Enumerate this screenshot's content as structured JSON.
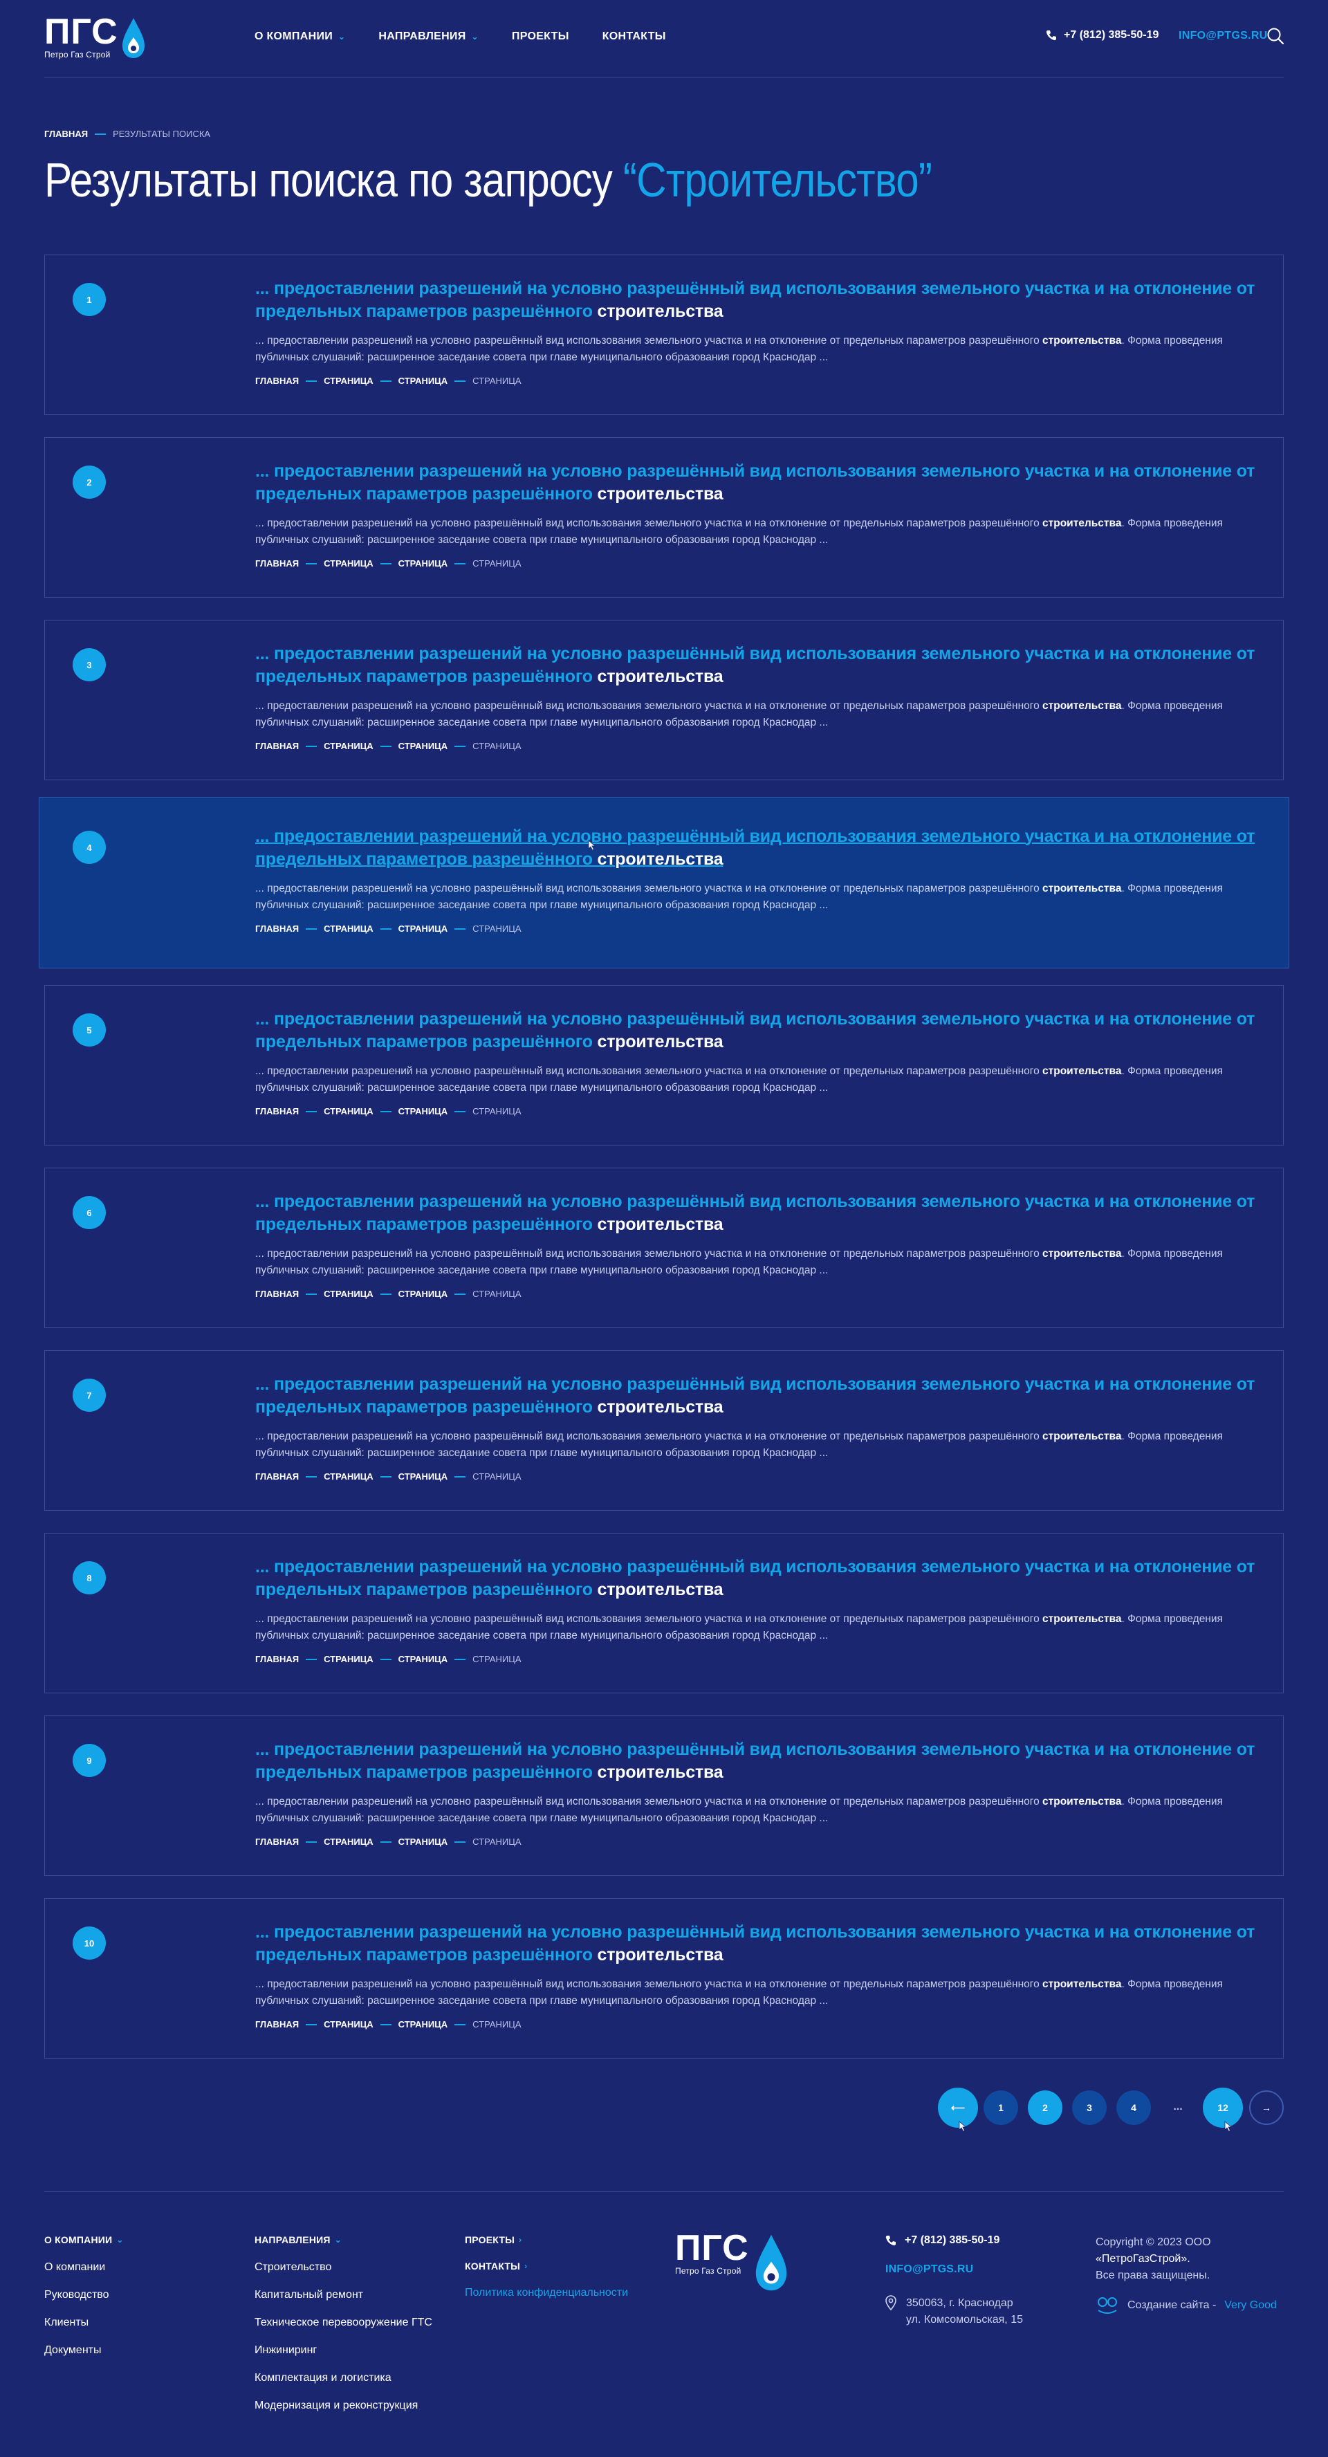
{
  "header": {
    "logo_big": "ПГС",
    "logo_small": "Петро Газ Строй",
    "nav": [
      {
        "label": "О КОМПАНИИ",
        "dropdown": true
      },
      {
        "label": "НАПРАВЛЕНИЯ",
        "dropdown": true
      },
      {
        "label": "ПРОЕКТЫ",
        "dropdown": false
      },
      {
        "label": "КОНТАКТЫ",
        "dropdown": false
      }
    ],
    "phone": "+7 (812) 385-50-19",
    "email": "INFO@PTGS.RU"
  },
  "breadcrumb": {
    "home": "ГЛАВНАЯ",
    "current": "РЕЗУЛЬТАТЫ ПОИСКА"
  },
  "title": {
    "prefix": "Результаты поиска по запросу ",
    "query": "“Строительство”"
  },
  "results": [
    {
      "n": "1"
    },
    {
      "n": "2"
    },
    {
      "n": "3"
    },
    {
      "n": "4"
    },
    {
      "n": "5"
    },
    {
      "n": "6"
    },
    {
      "n": "7"
    },
    {
      "n": "8"
    },
    {
      "n": "9"
    },
    {
      "n": "10"
    }
  ],
  "result_template": {
    "title_lead": "... предоставлении разрешений на условно разрешённый вид использования земельного участка и на отклонение от предельных параметров разрешённого ",
    "title_hl": "строительства",
    "text_lead": "... предоставлении разрешений на условно разрешённый вид использования земельного участка и на отклонение от предельных параметров разрешённого ",
    "text_hl": "строительства",
    "text_tail": ". Форма проведения публичных слушаний: расширенное заседание совета при главе муниципального образования город Краснодар ...",
    "crumbs": [
      "ГЛАВНАЯ",
      "СТРАНИЦА",
      "СТРАНИЦА",
      "СТРАНИЦА"
    ]
  },
  "pagination": {
    "prev": "⟵",
    "pages": [
      "1",
      "2",
      "3",
      "4"
    ],
    "dots": "...",
    "last": "12",
    "next": "→"
  },
  "footer": {
    "company": {
      "head": "О КОМПАНИИ",
      "links": [
        "О компании",
        "Руководство",
        "Клиенты",
        "Документы"
      ]
    },
    "directions": {
      "head": "НАПРАВЛЕНИЯ",
      "links": [
        "Строительство",
        "Капитальный ремонт",
        "Техническое перевооружение ГТС",
        "Инжиниринг",
        "Комплектация и логистика",
        "Модернизация и реконструкция"
      ]
    },
    "projects": "ПРОЕКТЫ",
    "contacts": "КОНТАКТЫ",
    "policy": "Политика конфиденциальности",
    "phone": "+7 (812) 385-50-19",
    "email": "INFO@PTGS.RU",
    "address_1": "350063, г. Краснодар",
    "address_2": "ул. Комсомольская, 15",
    "copy_1": "Copyright © 2023 ООО",
    "copy_2": "«ПетроГазСтрой».",
    "copy_3": "Все права защищены.",
    "dev_label": "Создание сайта - ",
    "dev_name": "Very Good"
  },
  "colors": {
    "background": "#1b2671",
    "accent": "#14a4e8",
    "hover": "#0f3a8a"
  }
}
